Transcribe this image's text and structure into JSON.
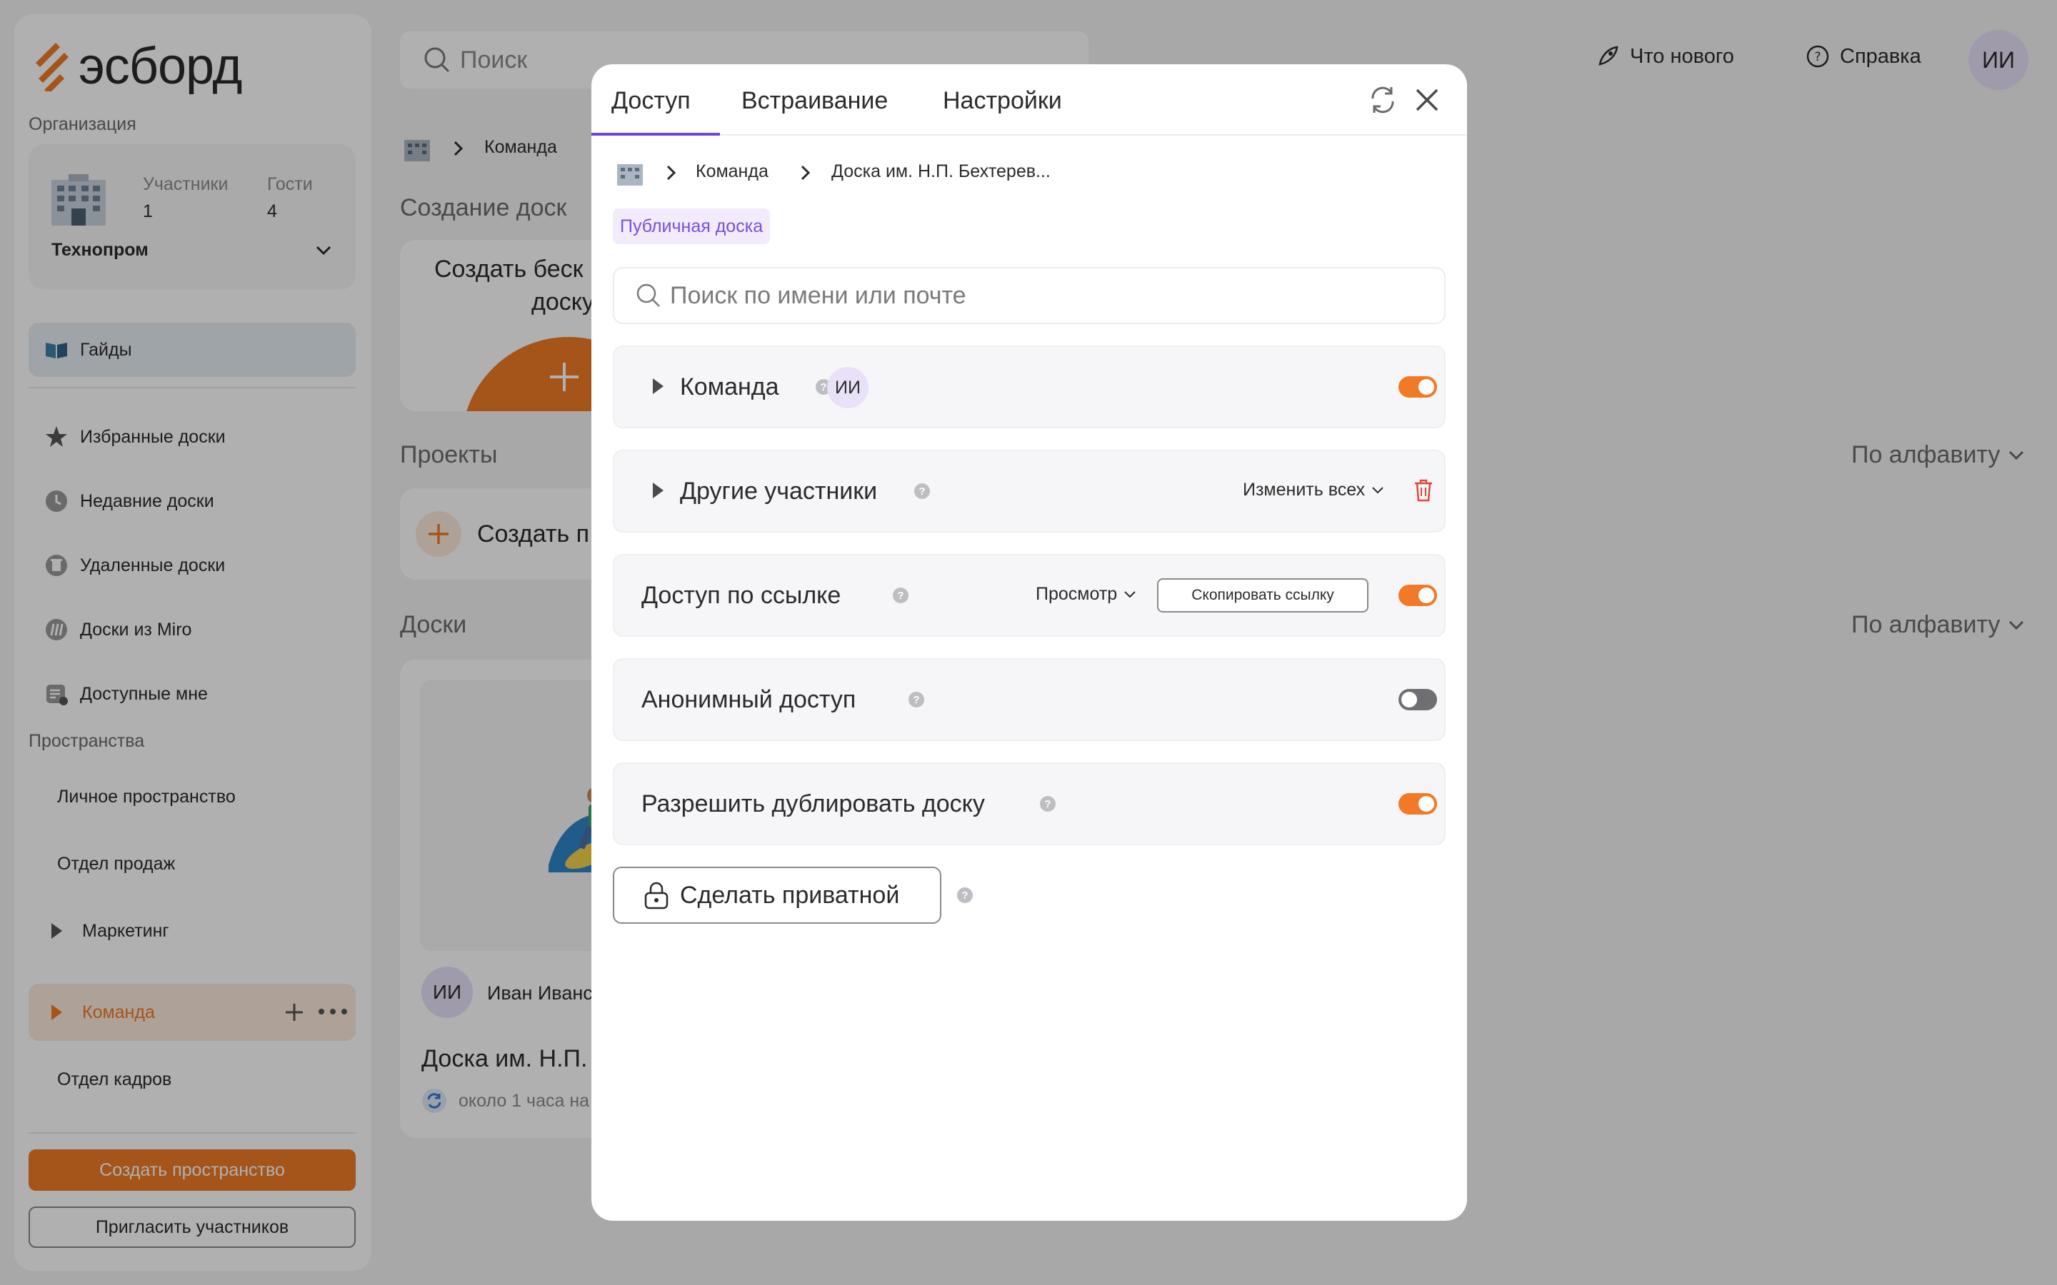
{
  "app": {
    "logo_text": "эсборд"
  },
  "sidebar": {
    "org_label": "Организация",
    "org": {
      "members_label": "Участники",
      "members_count": "1",
      "guests_label": "Гости",
      "guests_count": "4",
      "name": "Технопром"
    },
    "guides": "Гайды",
    "nav": [
      {
        "label": "Избранные доски",
        "icon": "star-icon"
      },
      {
        "label": "Недавние доски",
        "icon": "clock-icon"
      },
      {
        "label": "Удаленные доски",
        "icon": "trash-icon"
      },
      {
        "label": "Доски из Miro",
        "icon": "miro-icon"
      },
      {
        "label": "Доступные мне",
        "icon": "shared-icon"
      }
    ],
    "spaces_label": "Пространства",
    "spaces": [
      "Личное пространство",
      "Отдел продаж",
      "Маркетинг",
      "Команда",
      "Отдел кадров"
    ],
    "create_space": "Создать пространство",
    "invite": "Пригласить участников"
  },
  "header": {
    "search_placeholder": "Поиск",
    "whats_new": "Что нового",
    "help": "Справка",
    "avatar": "ИИ"
  },
  "main": {
    "breadcrumb": "Команда",
    "create_title": "Создание доск",
    "create_card_line1": "Создать беск",
    "create_card_line2": "доску",
    "projects_title": "Проекты",
    "projects_sort": "По алфавиту",
    "create_project": "Создать п",
    "boards_title": "Доски",
    "boards_sort": "По алфавиту",
    "board_owner_avatar": "ИИ",
    "board_owner": "Иван Иванс",
    "board_title": "Доска им. Н.П.",
    "board_updated": "около 1 часа на"
  },
  "modal": {
    "tabs": [
      "Доступ",
      "Встраивание",
      "Настройки"
    ],
    "breadcrumb": [
      "Команда",
      "Доска им. Н.П. Бехтерев..."
    ],
    "badge": "Публичная доска",
    "search_placeholder": "Поиск по имени или почте",
    "team": {
      "label": "Команда",
      "avatar": "ИИ"
    },
    "others": {
      "label": "Другие участники",
      "change_all": "Изменить всех"
    },
    "link": {
      "label": "Доступ по ссылке",
      "mode": "Просмотр",
      "copy": "Скопировать ссылку"
    },
    "anon": {
      "label": "Анонимный доступ"
    },
    "dup": {
      "label": "Разрешить дублировать доску"
    },
    "make_private": "Сделать приватной",
    "help_glyph": "?",
    "colors": {
      "accent": "#f07a26",
      "purple": "#6c47d9",
      "badge_bg": "#f1ebfb"
    }
  }
}
